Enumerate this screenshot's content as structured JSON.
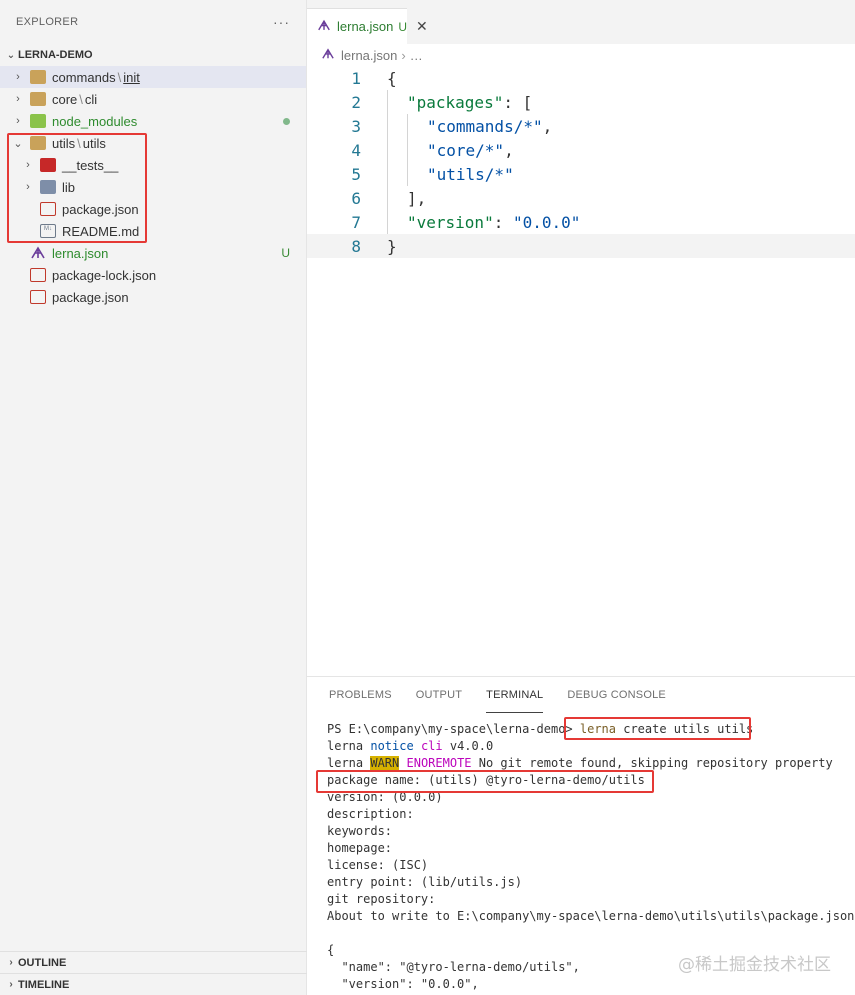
{
  "sidebar": {
    "title": "EXPLORER",
    "more": "···",
    "project": "LERNA-DEMO",
    "items": [
      {
        "name": "commands",
        "sub": "init",
        "depth": 0,
        "twisty": "›"
      },
      {
        "name": "core",
        "sub": "cli",
        "depth": 0,
        "twisty": "›"
      },
      {
        "name": "node_modules",
        "depth": 0,
        "twisty": "›"
      },
      {
        "name": "utils",
        "sub": "utils",
        "depth": 0,
        "twisty": "⌄"
      },
      {
        "name": "__tests__",
        "depth": 1,
        "twisty": "›"
      },
      {
        "name": "lib",
        "depth": 1,
        "twisty": "›"
      },
      {
        "name": "package.json",
        "depth": 1
      },
      {
        "name": "README.md",
        "depth": 1
      },
      {
        "name": "lerna.json",
        "depth": 0,
        "badge": "U"
      },
      {
        "name": "package-lock.json",
        "depth": 0
      },
      {
        "name": "package.json",
        "depth": 0
      }
    ],
    "md_icon": "M↓",
    "outline": "OUTLINE",
    "timeline": "TIMELINE"
  },
  "editor": {
    "tab": {
      "label": "lerna.json",
      "status": "U",
      "close": "✕"
    },
    "breadcrumb": {
      "file": "lerna.json",
      "rest": "…"
    },
    "line_numbers": [
      "1",
      "2",
      "3",
      "4",
      "5",
      "6",
      "7",
      "8"
    ],
    "code": {
      "l1": "{",
      "l2_key": "\"packages\"",
      "l2_rest": ": [",
      "l3": "\"commands/*\"",
      "l4": "\"core/*\"",
      "l5": "\"utils/*\"",
      "l6": "],",
      "l7_key": "\"version\"",
      "l7_colon": ": ",
      "l7_val": "\"0.0.0\"",
      "l8": "}",
      "comma": ","
    }
  },
  "panel": {
    "tabs": [
      "PROBLEMS",
      "OUTPUT",
      "TERMINAL",
      "DEBUG CONSOLE"
    ],
    "terminal": {
      "prompt": "PS E:\\company\\my-space\\lerna-demo>",
      "cmd_name": "lerna",
      "cmd_args": " create utils utils",
      "l2_a": "lerna ",
      "l2_notice": "notice",
      "l2_cli": " cli",
      "l2_ver": " v4.0.0",
      "l3_a": "lerna ",
      "l3_warn": "WARN",
      "l3_code": " ENOREMOTE",
      "l3_msg": " No git remote found, skipping repository property",
      "l4": "package name: (utils) @tyro-lerna-demo/utils",
      "l5": "version: (0.0.0)",
      "l6": "description:",
      "l7": "keywords:",
      "l8": "homepage:",
      "l9": "license: (ISC)",
      "l10": "entry point: (lib/utils.js)",
      "l11": "git repository:",
      "l12": "About to write to E:\\company\\my-space\\lerna-demo\\utils\\utils\\package.json:",
      "l13": "",
      "l14": "{",
      "l15": "  \"name\": \"@tyro-lerna-demo/utils\",",
      "l16": "  \"version\": \"0.0.0\","
    }
  },
  "watermark": "@稀土掘金技术社区",
  "colors": {
    "accent_red": "#e53935",
    "git_green": "#388a34"
  }
}
